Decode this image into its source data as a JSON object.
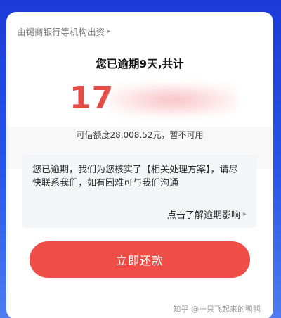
{
  "card": {
    "source_label": "由锡商银行等机构出资",
    "headline": "您已逾期9天,共计",
    "amount_visible": "17",
    "credit_limit_text": "可借额度28,008.52元，暂不可用",
    "notice": {
      "text": "您已逾期，我们为您核实了【相关处理方案】，请尽快联系我们，如有困难可与我们沟通",
      "link_label": "点击了解逾期影响"
    },
    "repay_button_label": "立即还款"
  },
  "watermark": "知乎 @一只飞起来的鸭鸭",
  "colors": {
    "background_blue": "#2a56e8",
    "accent_red": "#ee4e47",
    "amount_red": "#e24c45"
  },
  "icons": {
    "source_chevron": "chevron-right-icon",
    "link_chevron": "chevron-right-icon"
  }
}
